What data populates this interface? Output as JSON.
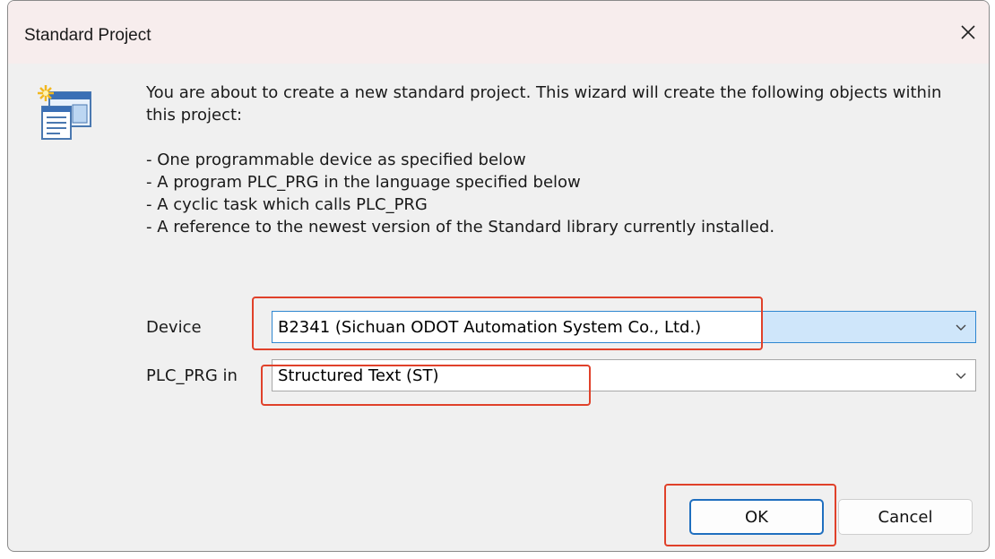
{
  "window": {
    "title": "Standard Project",
    "close_label": "✕"
  },
  "icons": {
    "wizard": "standard-project-wizard-icon",
    "close": "close-icon",
    "dropdown": "chevron-down-icon"
  },
  "message": {
    "intro": "You are about to create a new standard project. This wizard will create the following objects within this project:",
    "items": [
      "- One programmable device as specified below",
      "- A program PLC_PRG in the language specified below",
      "- A cyclic task which calls PLC_PRG",
      "- A reference to the newest version of the Standard library currently installed."
    ]
  },
  "device": {
    "label": "Device",
    "value": "B2341 (Sichuan ODOT Automation System Co., Ltd.)"
  },
  "plc_prg": {
    "label": "PLC_PRG in",
    "value": "Structured Text (ST)"
  },
  "buttons": {
    "ok": "OK",
    "cancel": "Cancel"
  },
  "colors": {
    "highlight": "#e0412a",
    "focus_border": "#2e86d0",
    "default_button_border": "#1f6fbf",
    "titlebar_bg": "#f7eded",
    "dialog_bg": "#f0f0f0"
  }
}
